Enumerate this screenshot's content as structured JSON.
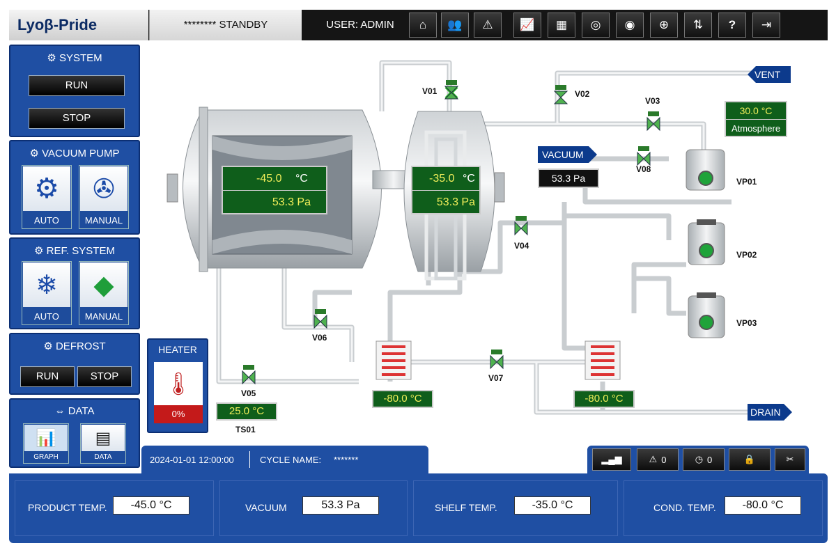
{
  "header": {
    "logo_text": "Lyoβ-Pride",
    "status": "******** STANDBY",
    "user": "USER: ADMIN",
    "toolbar_icons": [
      "home-icon",
      "users-icon",
      "alarm-icon",
      "trend-icon",
      "recipe-icon",
      "target-icon",
      "target2-icon",
      "target3-icon",
      "network-icon",
      "help-icon",
      "logout-icon"
    ]
  },
  "system": {
    "title": "SYSTEM",
    "run": "RUN",
    "stop": "STOP"
  },
  "vacuum_pump": {
    "title": "VACUUM PUMP",
    "auto": "AUTO",
    "manual": "MANUAL"
  },
  "ref_system": {
    "title": "REF. SYSTEM",
    "auto": "AUTO",
    "manual": "MANUAL"
  },
  "defrost": {
    "title": "DEFROST",
    "run": "RUN",
    "stop": "STOP"
  },
  "data_panel": {
    "title": "DATA",
    "graph": "GRAPH",
    "data": "DATA"
  },
  "heater": {
    "title": "HEATER",
    "value": "0%"
  },
  "process": {
    "chamber": {
      "temp": "-45.0",
      "temp_unit": "°C",
      "pressure": "53.3 Pa"
    },
    "condenser": {
      "temp": "-35.0",
      "temp_unit": "°C",
      "pressure": "53.3 Pa"
    },
    "atmosphere": {
      "temp": "30.0 °C",
      "label": "Atmosphere"
    },
    "vent_label": "VENT",
    "vacuum_label": "VACUUM",
    "vacuum_value": "53.3 Pa",
    "drain_label": "DRAIN",
    "ts01": {
      "value": "25.0  °C",
      "label": "TS01"
    },
    "hx1_temp": "-80.0  °C",
    "hx2_temp": "-80.0  °C",
    "valves": [
      "V01",
      "V02",
      "V03",
      "V04",
      "V05",
      "V06",
      "V07",
      "V08"
    ],
    "pumps": [
      "VP01",
      "VP02",
      "VP03"
    ]
  },
  "info": {
    "datetime": "2024-01-01  12:00:00",
    "cycle_label": "CYCLE NAME:",
    "cycle_value": "*******"
  },
  "status_bar": {
    "alarm_count": "0",
    "timer_count": "0"
  },
  "readouts": [
    {
      "label": "PRODUCT TEMP.",
      "value": "-45.0  °C"
    },
    {
      "label": "VACUUM",
      "value": "53.3 Pa"
    },
    {
      "label": "SHELF TEMP.",
      "value": "-35.0  °C"
    },
    {
      "label": "COND. TEMP.",
      "value": "-80.0  °C"
    }
  ],
  "colors": {
    "panel_blue": "#1f4fa3",
    "display_green": "#0f5e1b",
    "display_text": "#f2ef5a",
    "tag_blue": "#0c3a8c"
  }
}
